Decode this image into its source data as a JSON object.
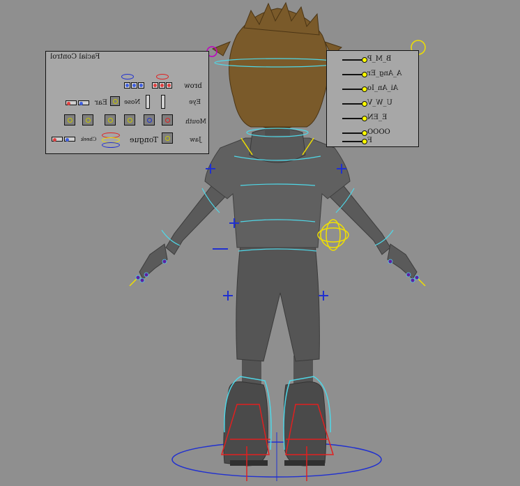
{
  "viewport": {
    "background": "#8f8f8f"
  },
  "facial_panel": {
    "title": "Facial Control",
    "labels": {
      "brow": "brow",
      "eye": "Eye",
      "nose": "Nose",
      "ear": "Ear",
      "mouth": "Mouth",
      "cheek": "Cheek",
      "jaw": "Jaw",
      "tongue": "Tongue"
    }
  },
  "phoneme_panel": {
    "items": [
      "B_M_P",
      "A_Ang_Er",
      "Ai_An_Io",
      "U_W_V",
      "E_EN",
      "OOOO",
      "F"
    ]
  },
  "colors": {
    "rig_cyan": "#4fd8e8",
    "rig_yellow": "#f0e000",
    "rig_blue": "#2030d0",
    "rig_red": "#e02020",
    "rig_magenta": "#c000c0",
    "body_gray": "#5a5a5a",
    "hair_brown": "#7a5a2a"
  }
}
